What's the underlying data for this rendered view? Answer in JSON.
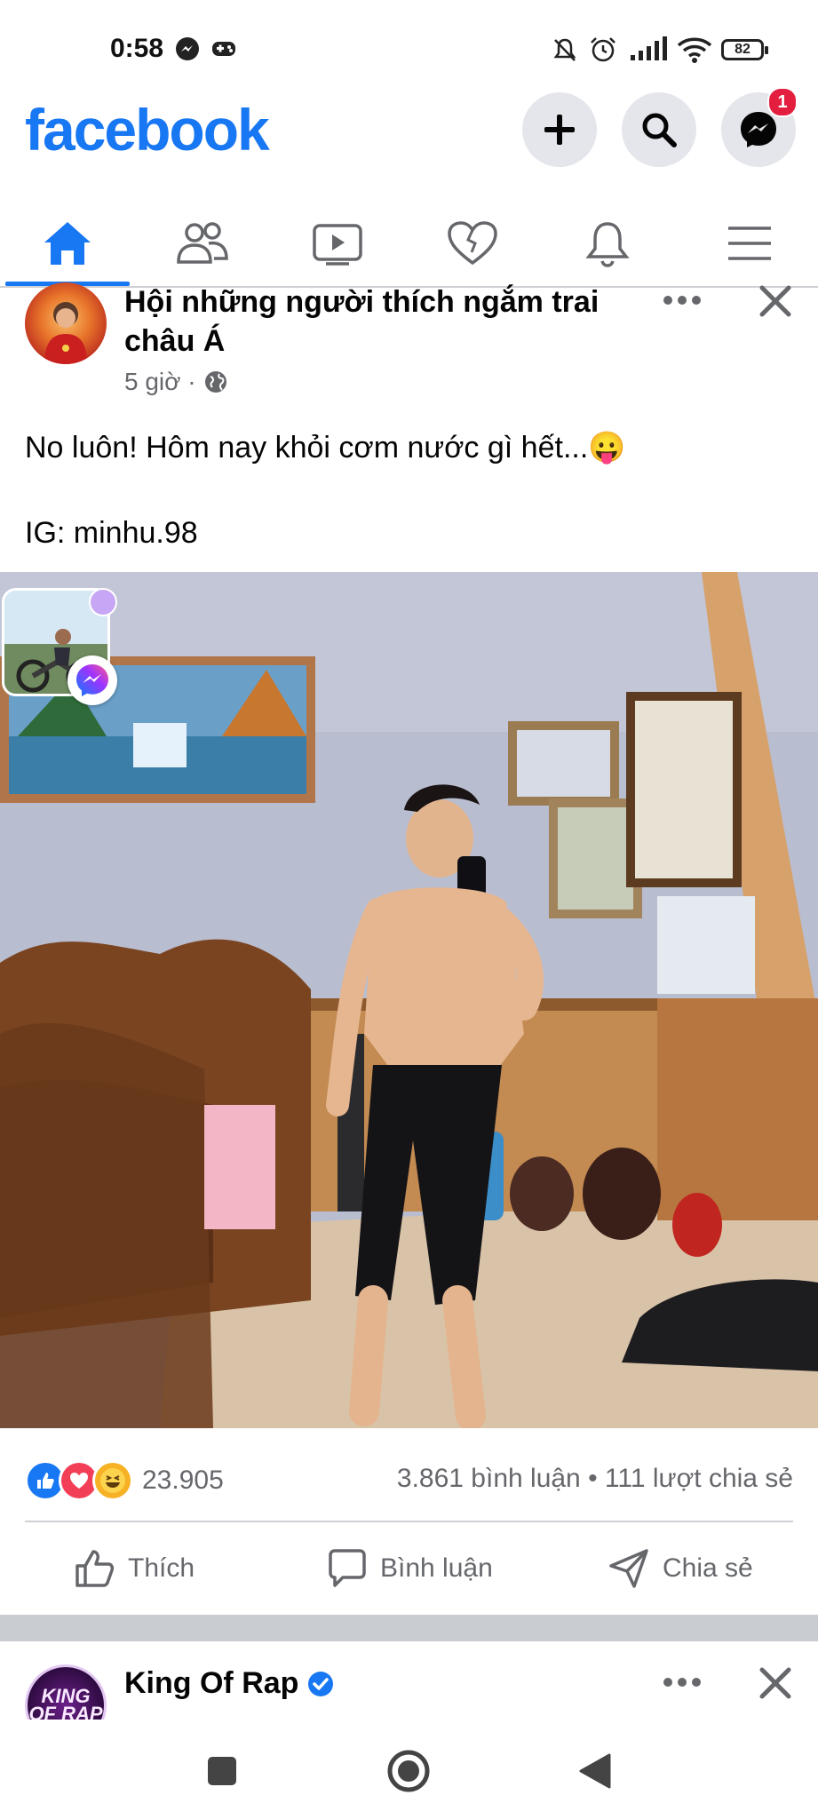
{
  "status_bar": {
    "time": "0:58",
    "battery": "82"
  },
  "header": {
    "logo": "facebook",
    "messenger_badge": "1"
  },
  "tabs": [
    {
      "name": "home-icon",
      "active": true
    },
    {
      "name": "friends-icon",
      "active": false
    },
    {
      "name": "watch-icon",
      "active": false
    },
    {
      "name": "dating-icon",
      "active": false
    },
    {
      "name": "notifications-icon",
      "active": false
    },
    {
      "name": "menu-icon",
      "active": false
    }
  ],
  "post": {
    "group_name": "Hội những người thích ngắm trai châu Á",
    "time": "5 giờ ·",
    "text_line1": "No luôn! Hôm nay khỏi cơm nước gì hết...😛",
    "text_line2": "IG: minhu.98",
    "reaction_count": "23.905",
    "stats": "3.861 bình luận • 111 lượt chia sẻ",
    "actions": {
      "like": "Thích",
      "comment": "Bình luận",
      "share": "Chia sẻ"
    }
  },
  "next_post": {
    "page_name": "King Of Rap",
    "avatar_text": "KING OF RAP"
  },
  "colors": {
    "brand": "#1877f2",
    "secondary_text": "#65676b",
    "badge": "#e41e3f"
  }
}
